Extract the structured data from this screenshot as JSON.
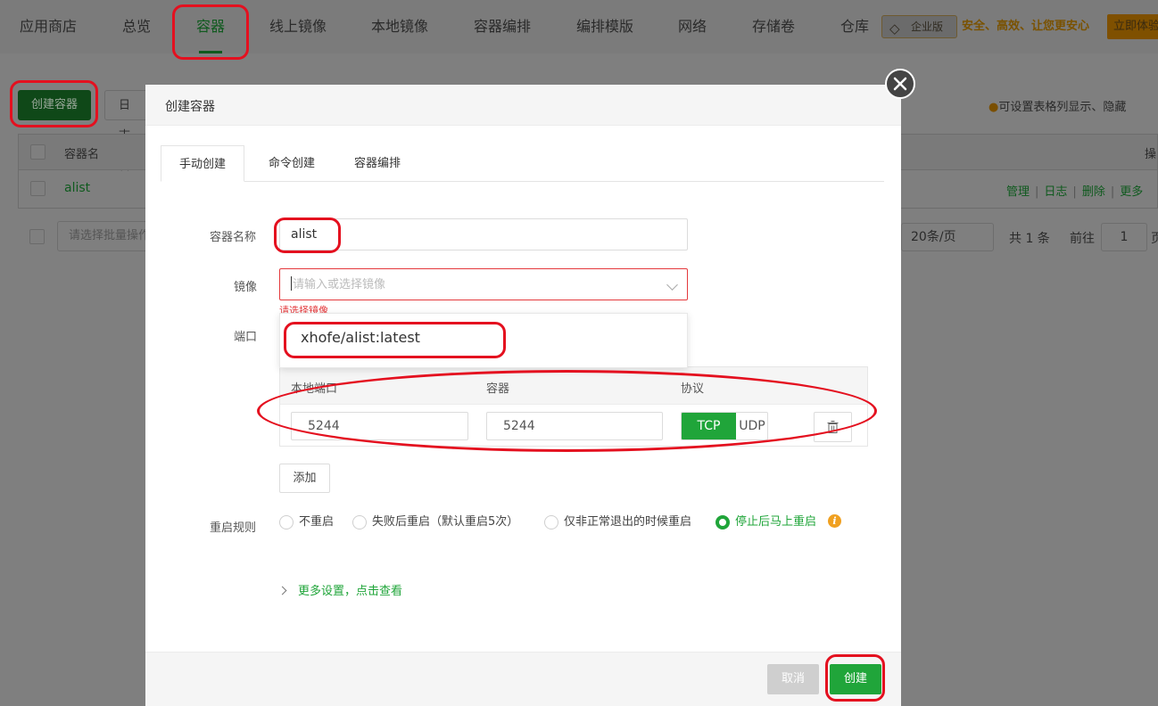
{
  "nav": {
    "items": [
      "应用商店",
      "总览",
      "容器",
      "线上镜像",
      "本地镜像",
      "容器编排",
      "编排模版",
      "网络",
      "存储卷",
      "仓库"
    ],
    "active": "容器",
    "enterprise_badge": "企业版",
    "enterprise_slogan": "安全、高效、让您更安心",
    "trial_label": "立即体验"
  },
  "background": {
    "create_button": "创建容器",
    "log_button": "日志管",
    "tip": "可设置表格列显示、隐藏",
    "table": {
      "col_name": "容器名",
      "col_ops": "操",
      "row_name": "alist",
      "actions": [
        "管理",
        "日志",
        "删除",
        "更多"
      ]
    },
    "batch_placeholder": "请选择批量操作",
    "page_size": "20条/页",
    "total": "共 1 条",
    "goto": "前往",
    "page": "1",
    "page_unit": "页"
  },
  "modal": {
    "title": "创建容器",
    "tabs": [
      "手动创建",
      "命令创建",
      "容器编排"
    ],
    "active_tab": "手动创建",
    "name_label": "容器名称",
    "name_value": "alist",
    "image_label": "镜像",
    "image_placeholder": "请输入或选择镜像",
    "image_error": "请选择镜像",
    "dropdown_option": "xhofe/alist:latest",
    "port_label": "端口",
    "port_table": {
      "headers": [
        "本地端口",
        "容器",
        "协议"
      ],
      "local_port": "5244",
      "container_port": "5244",
      "protocols": [
        "TCP",
        "UDP"
      ],
      "selected_protocol": "TCP"
    },
    "add_button": "添加",
    "restart_label": "重启规则",
    "restart_options": [
      "不重启",
      "失败后重启（默认重启5次）",
      "仅非正常退出的时候重启",
      "停止后马上重启"
    ],
    "restart_selected": "停止后马上重启",
    "more_settings": "更多设置，点击查看",
    "cancel_button": "取消",
    "create_button": "创建"
  },
  "colors": {
    "primary_green": "#20a53a",
    "error_red": "#e4393c",
    "annotation_red": "#e4101f",
    "warning_orange": "#f0a020"
  }
}
